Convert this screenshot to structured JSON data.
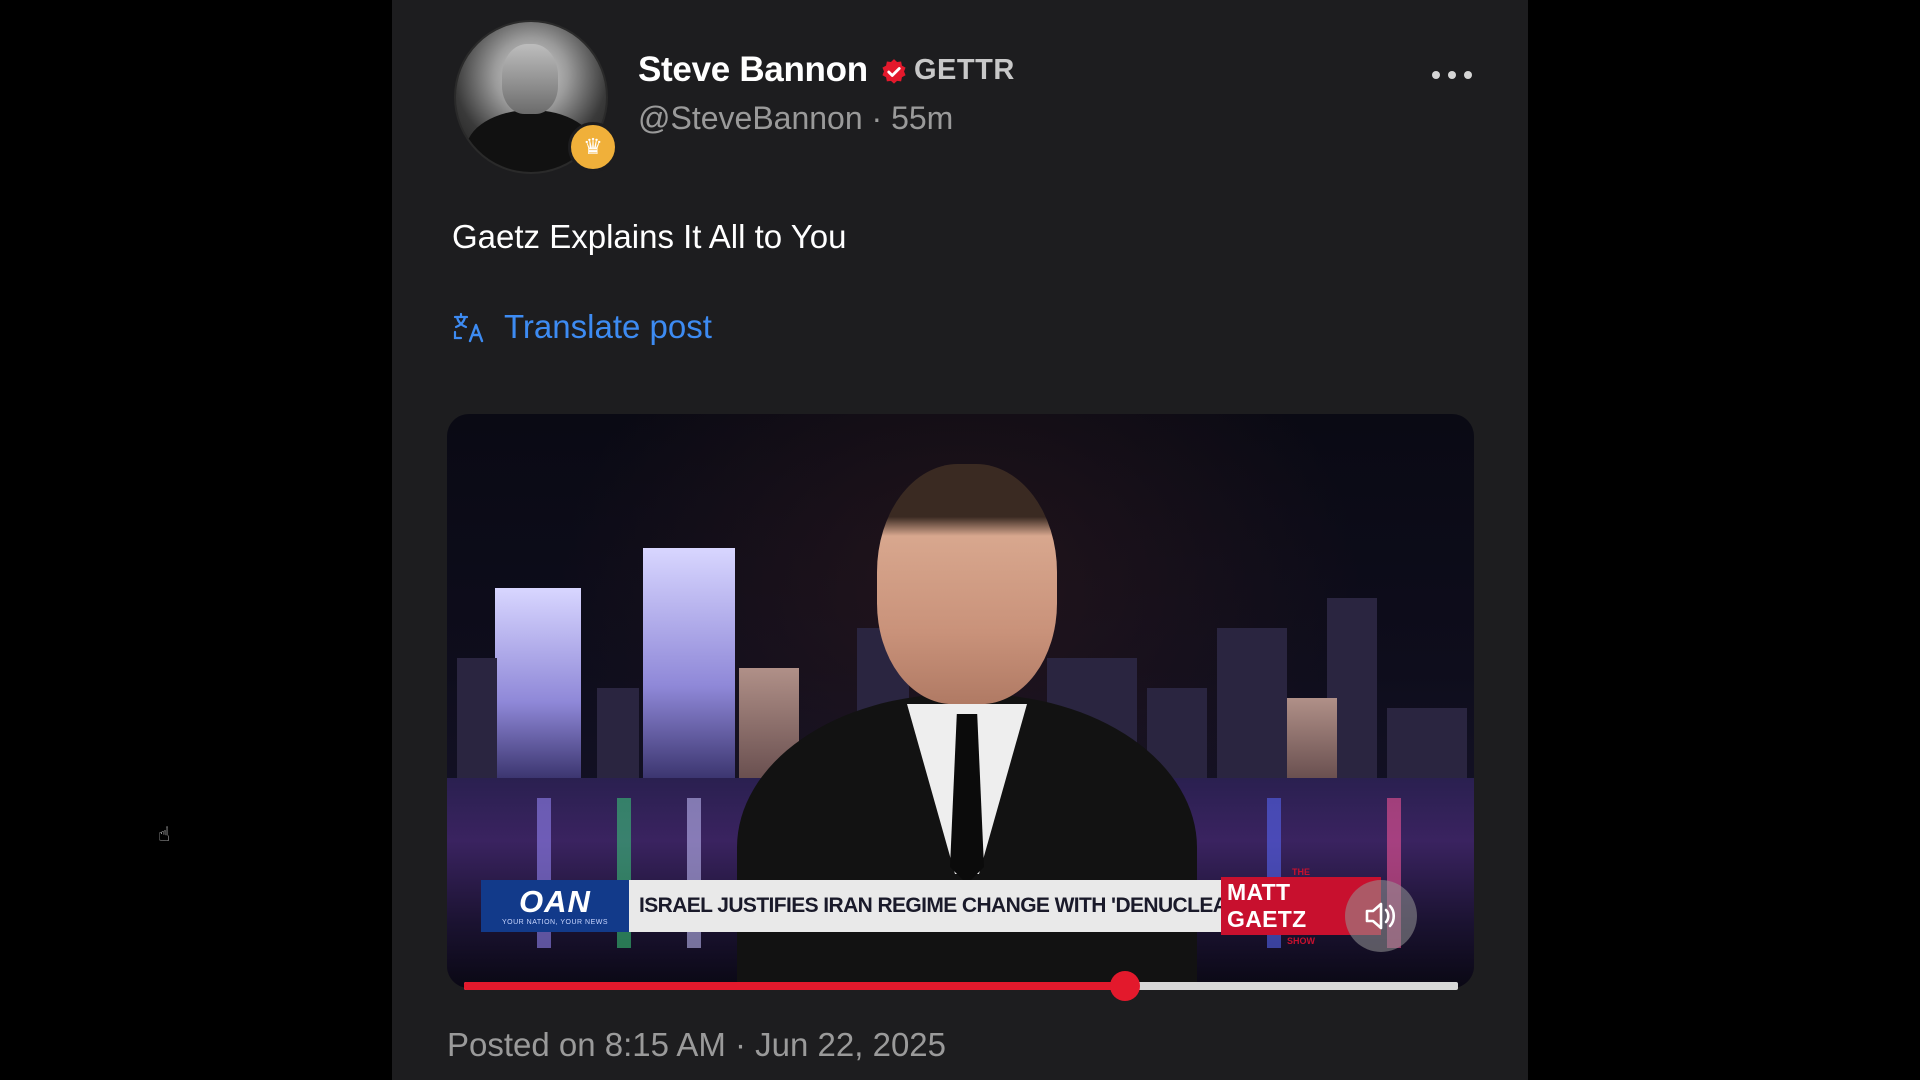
{
  "cursor": {
    "icon": "hand-pointer-icon",
    "glyph": "☝"
  },
  "post": {
    "author": {
      "name": "Steve Bannon",
      "platform_label": "GETTR",
      "handle_time": "@SteveBannon · 55m",
      "avatar_icon": "avatar-portrait",
      "badge_icon": "crown-icon",
      "badge_glyph": "♛",
      "verified_icon": "verified-badge-icon",
      "verified_color": "#e3192c"
    },
    "more_icon": "more-dots-icon",
    "text": "Gaetz Explains It All to You",
    "translate": {
      "label": "Translate post",
      "icon": "translate-icon",
      "color": "#3d8bf2"
    },
    "video": {
      "ticker": {
        "network": "OAN",
        "network_tagline": "YOUR NATION, YOUR NEWS",
        "headline": "ISRAEL JUSTIFIES IRAN REGIME CHANGE WITH 'DENUCLEARIZATION'",
        "show_prefix": "THE",
        "show_name": "MATT GAETZ",
        "show_suffix": "SHOW"
      },
      "volume_icon": "volume-icon",
      "progress": 0.665,
      "progress_color": "#e3192c"
    },
    "posted": "Posted on 8:15 AM · Jun 22, 2025"
  }
}
